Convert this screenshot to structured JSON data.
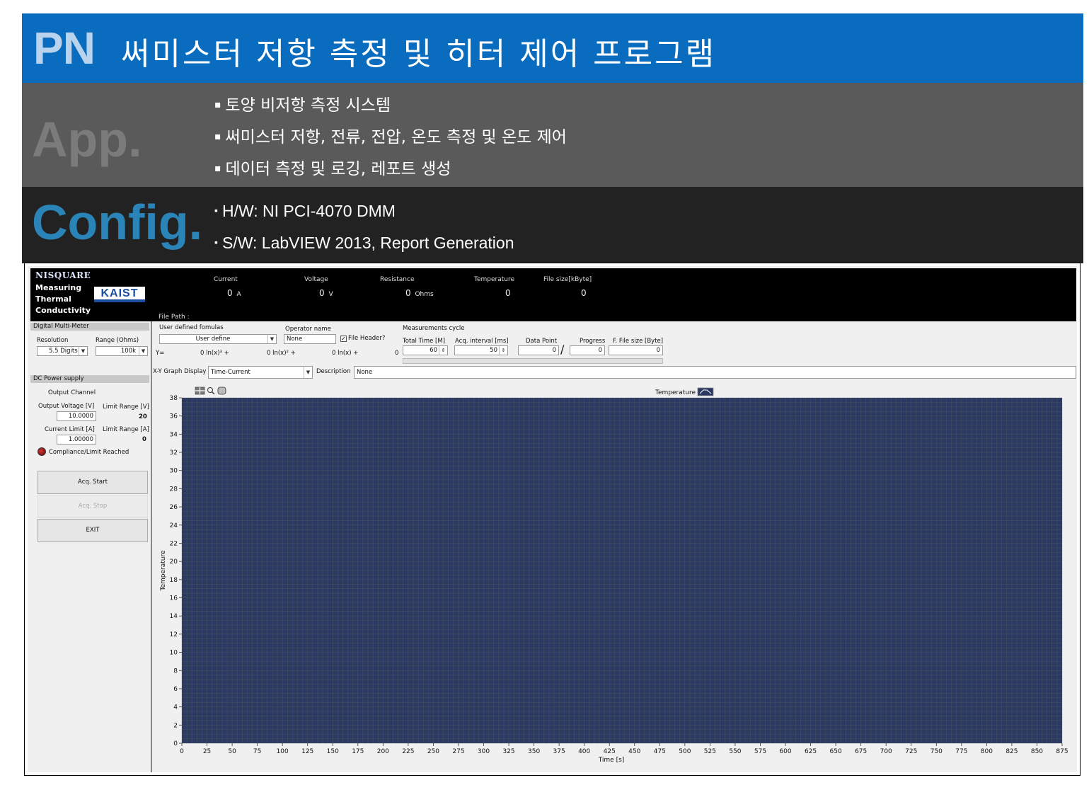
{
  "slide": {
    "pn_tag": "PN",
    "title": "써미스터 저항 측정 및 히터 제어 프로그램",
    "app_tag": "App.",
    "app_items": [
      "토양 비저항 측정 시스템",
      "써미스터 저항, 전류, 전압, 온도 측정 및 온도 제어",
      "데이터 측정 및 로깅, 레포트 생성"
    ],
    "config_tag": "Config.",
    "config_items": [
      "H/W: NI PCI-4070 DMM",
      "S/W: LabVIEW 2013,  Report Generation"
    ]
  },
  "logo": {
    "brand": "NISQUARE",
    "line1": "Measuring",
    "line2": "Thermal",
    "line3": "Conductivity",
    "kaist": "KAIST"
  },
  "status": {
    "current_label": "Current",
    "current_value": "0",
    "current_unit": "A",
    "voltage_label": "Voltage",
    "voltage_value": "0",
    "voltage_unit": "V",
    "resistance_label": "Resistance",
    "resistance_value": "0",
    "resistance_unit": "Ohms",
    "temperature_label": "Temperature",
    "temperature_value": "0",
    "filesize_label": "File size[kByte]",
    "filesize_value": "0",
    "filepath_label": "File Path",
    "filepath_value": ":"
  },
  "dmm": {
    "header": "Digital Multi-Meter",
    "resolution_label": "Resolution",
    "resolution_value": "5.5 Digits",
    "range_label": "Range (Ohms)",
    "range_value": "100k"
  },
  "dc": {
    "header": "DC Power supply",
    "output_channel_label": "Output Channel",
    "output_voltage_label": "Output Voltage [V]",
    "output_voltage_value": "10.0000",
    "limit_range_v_label": "Limit Range [V]",
    "limit_range_v_value": "20",
    "current_limit_label": "Current Limit [A]",
    "current_limit_value": "1.00000",
    "limit_range_a_label": "Limit Range [A]",
    "limit_range_a_value": "0",
    "compliance_label": "Compliance/Limit Reached"
  },
  "buttons": {
    "acq_start": "Acq. Start",
    "acq_stop": "Acq. Stop",
    "exit": "EXIT"
  },
  "formula": {
    "label": "User defined fomulas",
    "value": "User define",
    "y_label": "Y=",
    "t1": "0 ln(x)³ +",
    "t2": "0 ln(x)² +",
    "t3": "0 ln(x) +",
    "t4": "0"
  },
  "operator": {
    "label": "Operator name",
    "value": "None",
    "file_header_label": "File Header?"
  },
  "measurement": {
    "cycle_label": "Measurements cycle",
    "total_time_label": "Total Time [M]",
    "total_time_value": "60",
    "acq_interval_label": "Acq. interval [ms]",
    "acq_interval_value": "50",
    "data_point_label": "Data Point",
    "data_point_value": "0",
    "progress_label": "Progress",
    "progress_value": "0",
    "file_size_label": "F. File size [Byte]",
    "file_size_value": "0",
    "separator": "/"
  },
  "graph": {
    "display_label": "X-Y Graph Display",
    "display_value": "Time-Current",
    "description_label": "Description",
    "description_value": "None",
    "legend_label": "Temperature"
  },
  "colors": {
    "banner_blue": "#0a6cbf",
    "plot_bg": "#2c3a63",
    "grid": "#5d6a58",
    "config_tag": "#2b84b8"
  },
  "chart_data": {
    "type": "line",
    "xlabel": "Time [s]",
    "ylabel": "Temperature",
    "xlim": [
      0,
      875
    ],
    "ylim": [
      0,
      38
    ],
    "x_ticks": [
      0,
      25,
      50,
      75,
      100,
      125,
      150,
      175,
      200,
      225,
      250,
      275,
      300,
      325,
      350,
      375,
      400,
      425,
      450,
      475,
      500,
      525,
      550,
      575,
      600,
      625,
      650,
      675,
      700,
      725,
      750,
      775,
      800,
      825,
      850,
      875
    ],
    "y_ticks": [
      0,
      2,
      4,
      6,
      8,
      10,
      12,
      14,
      16,
      18,
      20,
      22,
      24,
      26,
      28,
      30,
      32,
      34,
      36,
      38
    ],
    "grid": true,
    "series": [
      {
        "name": "Temperature",
        "x": [],
        "y": []
      }
    ]
  }
}
